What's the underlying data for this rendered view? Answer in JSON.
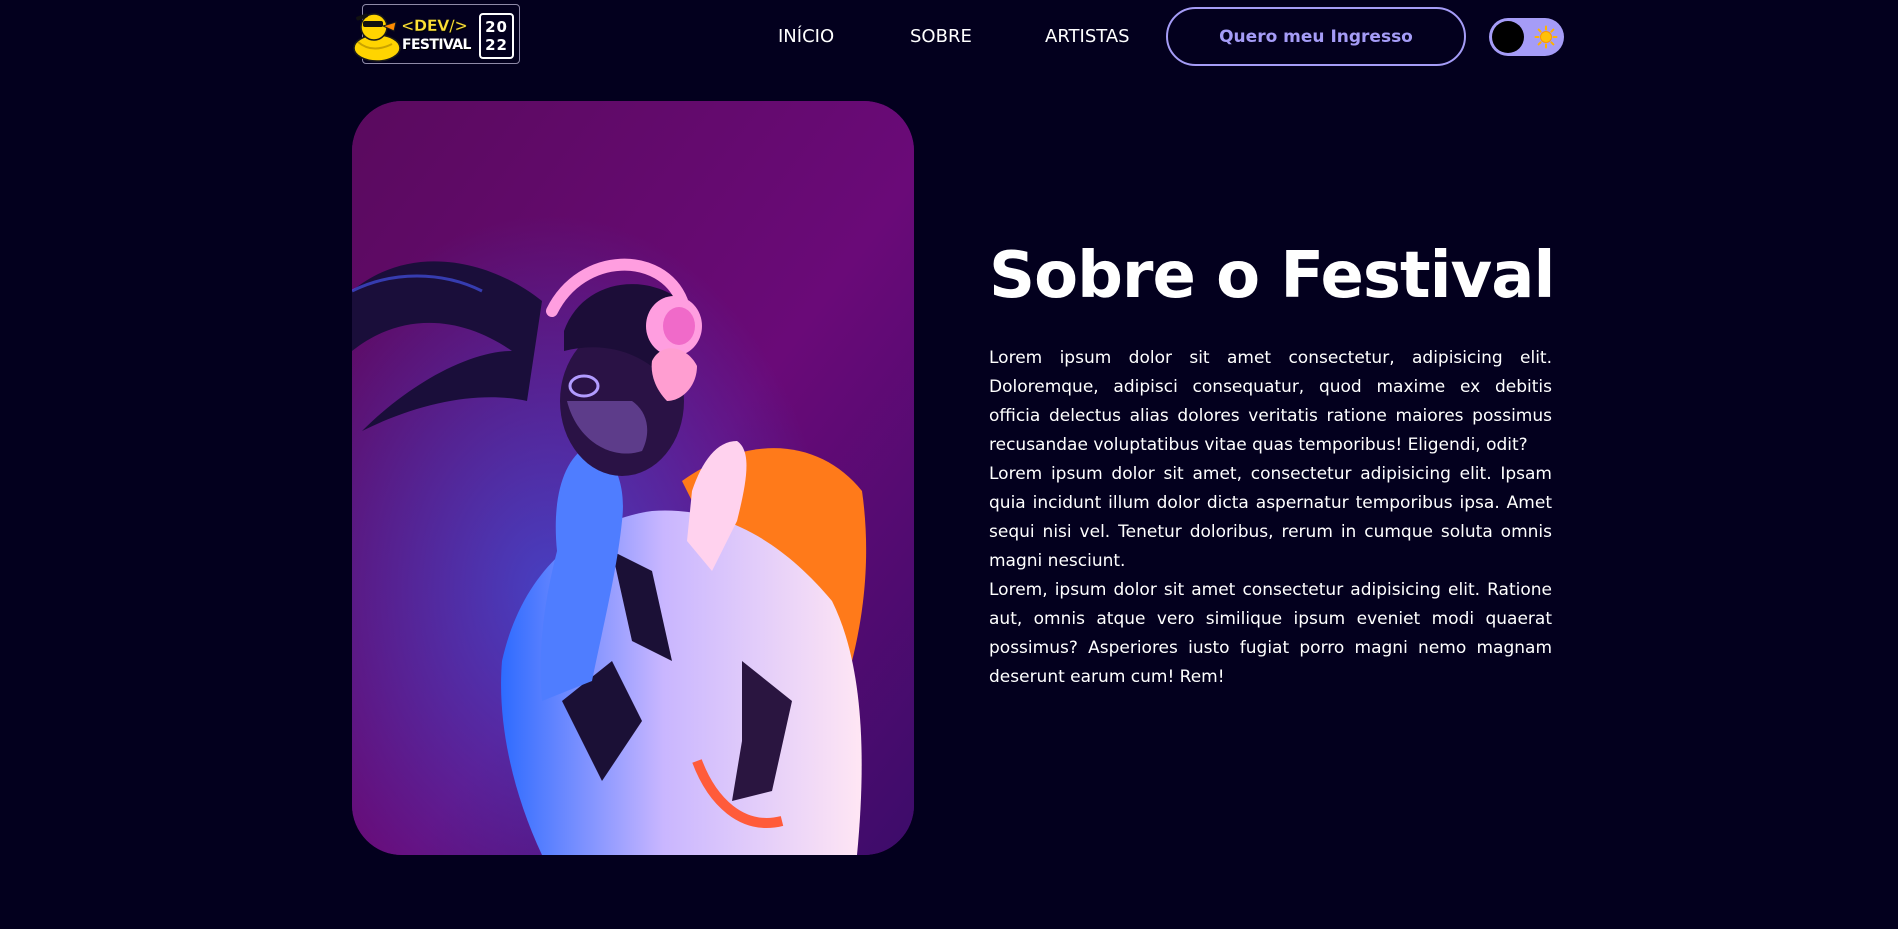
{
  "header": {
    "logo": {
      "line1": "<DEV/>",
      "line2": "FESTIVAL",
      "year_top": "20",
      "year_bottom": "22",
      "icon": "duck-icon"
    },
    "nav": [
      {
        "label": "INÍCIO"
      },
      {
        "label": "SOBRE"
      },
      {
        "label": "ARTISTAS"
      }
    ],
    "cta_label": "Quero meu Ingresso",
    "theme_toggle": {
      "state": "dark",
      "icon": "sun-icon"
    }
  },
  "about": {
    "title": "Sobre o Festival",
    "image": "photo of a person wearing pink headphones under neon purple light",
    "paragraphs": [
      "Lorem ipsum dolor sit amet consectetur, adipisicing elit. Doloremque, adipisci consequatur, quod maxime ex debitis officia delectus alias dolores veritatis ratione maiores possimus recusandae voluptatibus vitae quas temporibus! Eligendi, odit?",
      "Lorem ipsum dolor sit amet, consectetur adipisicing elit. Ipsam quia incidunt illum dolor dicta aspernatur temporibus ipsa. Amet sequi nisi vel. Tenetur doloribus, rerum in cumque soluta omnis magni nesciunt.",
      "Lorem, ipsum dolor sit amet consectetur adipisicing elit. Ratione aut, omnis atque vero similique ipsum eveniet modi quaerat possimus? Asperiores iusto fugiat porro magni nemo magnam deserunt earum cum! Rem!"
    ]
  },
  "colors": {
    "background": "#03001e",
    "accent": "#a59cf7",
    "text": "#ffffff",
    "logo_yellow": "#ffe135"
  }
}
